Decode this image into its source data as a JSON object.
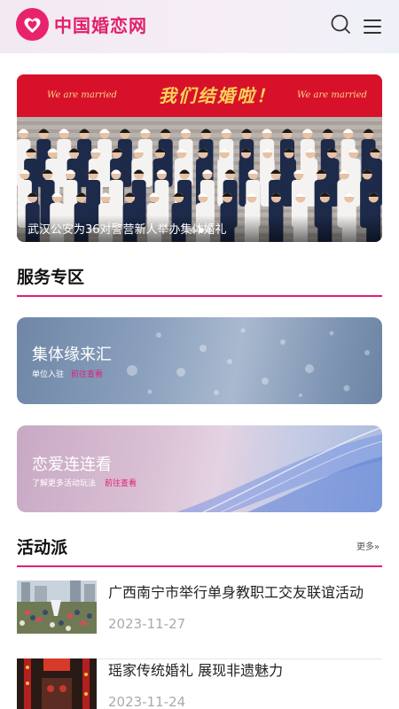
{
  "header": {
    "brand": "中国婚恋网",
    "logo_icon": "heart-logo-icon",
    "search_icon": "search-icon",
    "menu_icon": "hamburger-menu-icon",
    "brand_color": "#e0206b"
  },
  "banner": {
    "caption": "武汉公安为36对警营新人举办集体婚礼",
    "sign_text_left": "We are married",
    "sign_text_right": "We are married",
    "sign_text_center": "我们结婚啦！",
    "slide_count": 3,
    "active_slide": 1
  },
  "services": {
    "title": "服务专区",
    "cards": [
      {
        "title": "集体缘来汇",
        "subtitle": "单位入驻",
        "link": "前往查看"
      },
      {
        "title": "恋爱连连看",
        "subtitle": "了解更多活动玩法",
        "link": "前往查看"
      }
    ]
  },
  "activities": {
    "title": "活动派",
    "more": "更多»",
    "items": [
      {
        "title": "广西南宁市举行单身教职工交友联谊活动",
        "date": "2023-11-27"
      },
      {
        "title": "瑶家传统婚礼 展现非遗魅力",
        "date": "2023-11-24"
      }
    ]
  },
  "accent_color": "#e0207a"
}
